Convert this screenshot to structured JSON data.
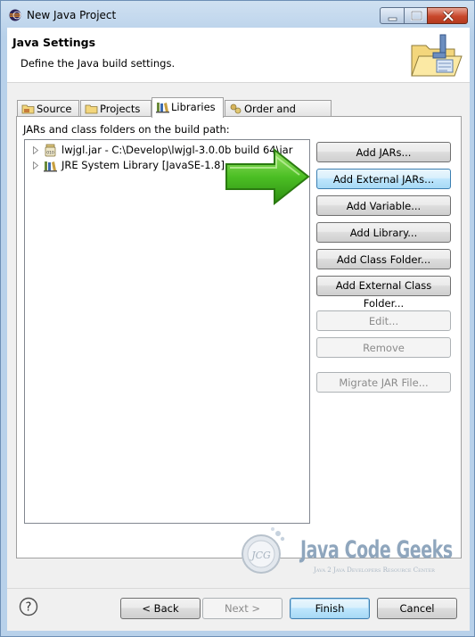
{
  "window": {
    "title": "New Java Project"
  },
  "header": {
    "title": "Java Settings",
    "description": "Define the Java build settings."
  },
  "tabs": [
    {
      "label": "Source",
      "icon": "source-folder-icon",
      "active": false
    },
    {
      "label": "Projects",
      "icon": "projects-folder-icon",
      "active": false
    },
    {
      "label": "Libraries",
      "icon": "libraries-icon",
      "active": true
    },
    {
      "label": "Order and Export",
      "icon": "order-export-icon",
      "active": false
    }
  ],
  "libraries": {
    "label": "JARs and class folders on the build path:",
    "entries": [
      {
        "label": "lwjgl.jar - C:\\Develop\\lwjgl-3.0.0b build 64\\jar",
        "icon": "jar-icon"
      },
      {
        "label": "JRE System Library [JavaSE-1.8]",
        "icon": "library-icon"
      }
    ],
    "buttons": [
      {
        "label": "Add JARs...",
        "enabled": true
      },
      {
        "label": "Add External JARs...",
        "enabled": true,
        "focused": true
      },
      {
        "label": "Add Variable...",
        "enabled": true
      },
      {
        "label": "Add Library...",
        "enabled": true
      },
      {
        "label": "Add Class Folder...",
        "enabled": true
      },
      {
        "label": "Add External Class Folder...",
        "enabled": true
      },
      {
        "label": "Edit...",
        "enabled": false
      },
      {
        "label": "Remove",
        "enabled": false
      },
      {
        "label": "Migrate JAR File...",
        "enabled": false
      }
    ]
  },
  "watermark": {
    "logo_text": "JCG",
    "brand": "Java Code Geeks",
    "tagline": "Java 2 Java Developers Resource Center"
  },
  "footer": {
    "back": "< Back",
    "next": "Next >",
    "finish": "Finish",
    "cancel": "Cancel"
  },
  "colors": {
    "accent": "#3c7fb1",
    "arrow_green": "#3fb21e",
    "close_red": "#c8472b"
  }
}
